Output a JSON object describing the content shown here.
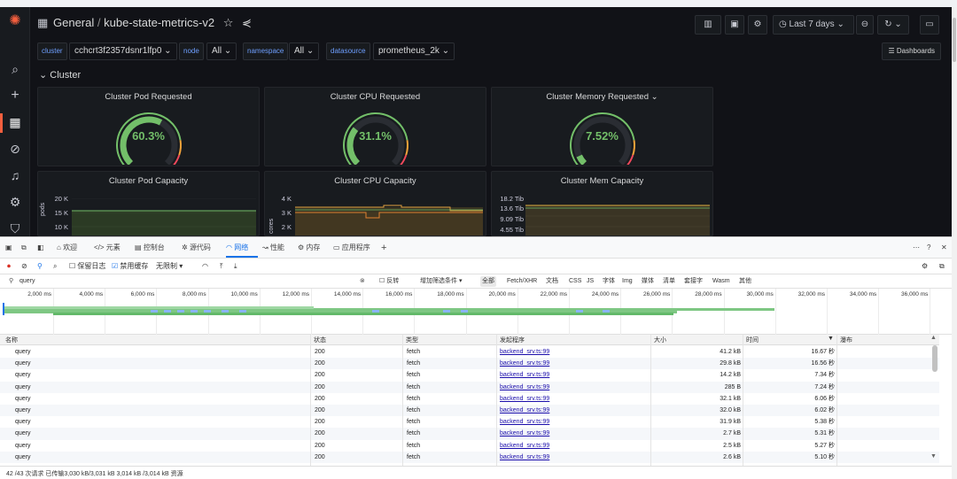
{
  "colors": {
    "accent": "#f55f3e",
    "gauge_green": "#73bf69",
    "link": "#1a0dab",
    "devtools_active": "#1a73e8"
  },
  "grafana": {
    "breadcrumb": {
      "section": "General",
      "separator": "/",
      "dashboard": "kube-state-metrics-v2"
    },
    "time_range": "Last 7 days",
    "variables": [
      {
        "label": "cluster",
        "value": "cchcrt3f2357dsnr1lfp0"
      },
      {
        "label": "node",
        "value": "All"
      },
      {
        "label": "namespace",
        "value": "All"
      },
      {
        "label": "datasource",
        "value": "prometheus_2k"
      }
    ],
    "dashboards_button": "Dashboards",
    "row_title": "Cluster",
    "gauges": [
      {
        "title": "Cluster Pod Requested",
        "value": "60.3%",
        "fraction": 0.603
      },
      {
        "title": "Cluster CPU Requested",
        "value": "31.1%",
        "fraction": 0.311
      },
      {
        "title": "Cluster Memory Requested",
        "value": "7.52%",
        "fraction": 0.0752
      }
    ],
    "capacity_panels": [
      {
        "title": "Cluster Pod Capacity",
        "yticks": [
          "20 K",
          "15 K",
          "10 K"
        ],
        "yaxis": "pods"
      },
      {
        "title": "Cluster CPU Capacity",
        "yticks": [
          "4 K",
          "3 K",
          "2 K"
        ],
        "yaxis": "cores"
      },
      {
        "title": "Cluster Mem Capacity",
        "yticks": [
          "18.2 Tib",
          "13.6 Tib",
          "9.09 Tib",
          "4.55 Tib"
        ],
        "yaxis": ""
      }
    ]
  },
  "devtools": {
    "tabs": [
      "欢迎",
      "元素",
      "控制台",
      "源代码",
      "网络",
      "性能",
      "内存",
      "应用程序"
    ],
    "active_tab": "网络",
    "toolbar": {
      "preserve_log": "保留日志",
      "disable_cache": "禁用缓存",
      "throttle": "无限制"
    },
    "filter": {
      "value": "query",
      "invert": "反转",
      "more_filters": "增加筛选条件"
    },
    "filter_chips": [
      "全部",
      "Fetch/XHR",
      "文档",
      "CSS",
      "JS",
      "字体",
      "Img",
      "媒体",
      "清单",
      "套接字",
      "Wasm",
      "其他"
    ],
    "timeline_ticks": [
      "2,000 ms",
      "4,000 ms",
      "6,000 ms",
      "8,000 ms",
      "10,000 ms",
      "12,000 ms",
      "14,000 ms",
      "16,000 ms",
      "18,000 ms",
      "20,000 ms",
      "22,000 ms",
      "24,000 ms",
      "26,000 ms",
      "28,000 ms",
      "30,000 ms",
      "32,000 ms",
      "34,000 ms",
      "36,000 ms"
    ],
    "columns": [
      "名称",
      "状态",
      "类型",
      "发起程序",
      "大小",
      "时间",
      "瀑布"
    ],
    "rows": [
      {
        "name": "query",
        "status": "200",
        "type": "fetch",
        "initiator": "backend_srv.ts:99",
        "size": "41.2 kB",
        "time": "16.67 秒"
      },
      {
        "name": "query",
        "status": "200",
        "type": "fetch",
        "initiator": "backend_srv.ts:99",
        "size": "29.8 kB",
        "time": "16.56 秒"
      },
      {
        "name": "query",
        "status": "200",
        "type": "fetch",
        "initiator": "backend_srv.ts:99",
        "size": "14.2 kB",
        "time": "7.34 秒"
      },
      {
        "name": "query",
        "status": "200",
        "type": "fetch",
        "initiator": "backend_srv.ts:99",
        "size": "285 B",
        "time": "7.24 秒"
      },
      {
        "name": "query",
        "status": "200",
        "type": "fetch",
        "initiator": "backend_srv.ts:99",
        "size": "32.1 kB",
        "time": "6.06 秒"
      },
      {
        "name": "query",
        "status": "200",
        "type": "fetch",
        "initiator": "backend_srv.ts:99",
        "size": "32.0 kB",
        "time": "6.02 秒"
      },
      {
        "name": "query",
        "status": "200",
        "type": "fetch",
        "initiator": "backend_srv.ts:99",
        "size": "31.9 kB",
        "time": "5.38 秒"
      },
      {
        "name": "query",
        "status": "200",
        "type": "fetch",
        "initiator": "backend_srv.ts:99",
        "size": "2.7 kB",
        "time": "5.31 秒"
      },
      {
        "name": "query",
        "status": "200",
        "type": "fetch",
        "initiator": "backend_srv.ts:99",
        "size": "2.5 kB",
        "time": "5.27 秒"
      },
      {
        "name": "query",
        "status": "200",
        "type": "fetch",
        "initiator": "backend_srv.ts:99",
        "size": "2.6 kB",
        "time": "5.10 秒"
      }
    ],
    "status_bar": "42 /43 次请求  已传输3,030 kB/3,031 kB  3,014 kB /3,014 kB 资源"
  }
}
